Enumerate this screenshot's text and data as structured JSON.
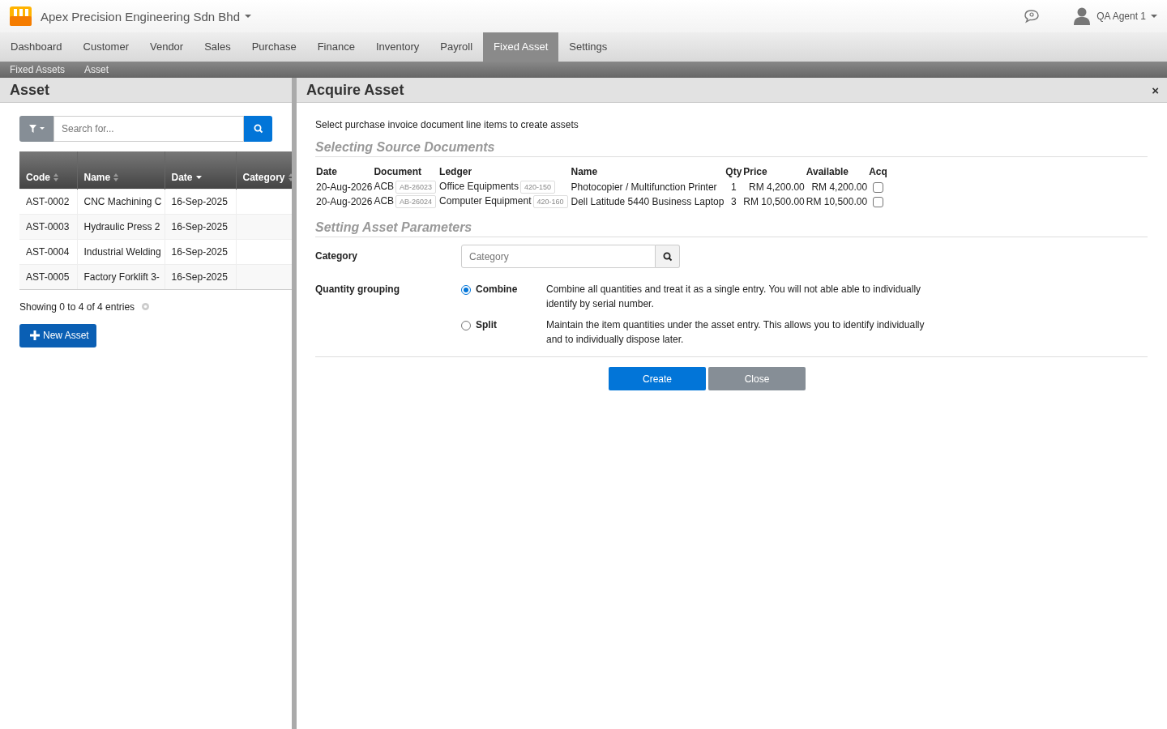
{
  "header": {
    "company": "Apex Precision Engineering Sdn Bhd",
    "user": "QA Agent 1"
  },
  "nav": [
    {
      "label": "Dashboard",
      "selected": false
    },
    {
      "label": "Customer",
      "selected": false
    },
    {
      "label": "Vendor",
      "selected": false
    },
    {
      "label": "Sales",
      "selected": false
    },
    {
      "label": "Purchase",
      "selected": false
    },
    {
      "label": "Finance",
      "selected": false
    },
    {
      "label": "Inventory",
      "selected": false
    },
    {
      "label": "Payroll",
      "selected": false
    },
    {
      "label": "Fixed Asset",
      "selected": true
    },
    {
      "label": "Settings",
      "selected": false
    }
  ],
  "breadcrumb": [
    "Fixed Assets",
    "Asset"
  ],
  "left_panel": {
    "title": "Asset",
    "search": {
      "placeholder": "Search for..."
    },
    "table": {
      "columns": [
        {
          "label": "Code",
          "sorted": false
        },
        {
          "label": "Name",
          "sorted": false
        },
        {
          "label": "Date",
          "sorted": true
        },
        {
          "label": "Category",
          "sorted": false
        }
      ],
      "rows": [
        [
          "AST-0002",
          "CNC Machining C",
          "16-Sep-2025",
          ""
        ],
        [
          "AST-0003",
          "Hydraulic Press 2",
          "16-Sep-2025",
          ""
        ],
        [
          "AST-0004",
          "Industrial Welding",
          "16-Sep-2025",
          ""
        ],
        [
          "AST-0005",
          "Factory Forklift 3-",
          "16-Sep-2025",
          ""
        ]
      ]
    },
    "info": "Showing 0 to 4 of 4 entries",
    "new_button": "New Asset"
  },
  "dialog": {
    "title": "Acquire Asset",
    "close": "×",
    "intro": "Select purchase invoice document line items to create assets",
    "source_heading": "Selecting Source Documents",
    "source_columns": [
      "Date",
      "Document",
      "Ledger",
      "Name",
      "Qty",
      "Price",
      "Available",
      "Acq"
    ],
    "source_rows": [
      {
        "date": "20-Aug-2026",
        "document": "ACB",
        "doc_tag": "AB-26023",
        "ledger": "Office Equipments",
        "ledger_tag": "420-150",
        "name": "Photocopier / Multifunction Printer",
        "qty": "1",
        "price": "RM 4,200.00",
        "available": "RM 4,200.00",
        "checked": false
      },
      {
        "date": "20-Aug-2026",
        "document": "ACB",
        "doc_tag": "AB-26024",
        "ledger": "Computer Equipment",
        "ledger_tag": "420-160",
        "name": "Dell Latitude 5440 Business Laptop",
        "qty": "3",
        "price": "RM 10,500.00",
        "available": "RM 10,500.00",
        "checked": false
      }
    ],
    "params_heading": "Setting Asset Parameters",
    "category": {
      "label": "Category",
      "placeholder": "Category"
    },
    "grouping": {
      "label": "Quantity grouping",
      "options": [
        {
          "label": "Combine",
          "description": "Combine all quantities and treat it as a single entry. You will not able able to individually identify by serial number.",
          "selected": true
        },
        {
          "label": "Split",
          "description": "Maintain the item quantities under the asset entry. This allows you to identify individually and to individually dispose later.",
          "selected": false
        }
      ]
    },
    "buttons": [
      {
        "label": "Create",
        "kind": "primary"
      },
      {
        "label": "Close",
        "kind": "secondary"
      }
    ]
  }
}
